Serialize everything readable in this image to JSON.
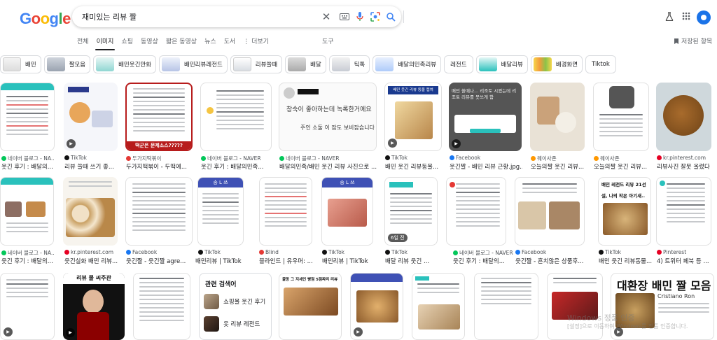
{
  "header": {
    "logo": "Google",
    "query": "재미있는 리뷰 짤"
  },
  "nav": {
    "tabs": [
      "전체",
      "이미지",
      "쇼핑",
      "동영상",
      "짧은 동영상",
      "뉴스",
      "도서",
      "⋮ 더보기"
    ],
    "active": "이미지",
    "tools": "도구",
    "saved": "저장된 항목"
  },
  "chips": [
    "배민",
    "짤모음",
    "배민웃긴만화",
    "배민리뷰레전드",
    "리뷰쓸때",
    "배달",
    "틱톡",
    "배달의민족리뷰",
    "레전드",
    "배달리뷰",
    "배경화면",
    "Tiktok"
  ],
  "results": {
    "row1": [
      {
        "source": "네이버 블로그 - NA...",
        "title": "웃긴 후기 : 배달의...",
        "video": false
      },
      {
        "source": "TikTok",
        "title": "리뷰 쓸때 쓰기 좋...",
        "video": true
      },
      {
        "source": "두가지떡볶이",
        "title": "두가지떡볶이 - 두떡에...",
        "video": false
      },
      {
        "source": "네이버 블로그 - NAVER",
        "title": "웃긴 후기 : 배달의민족...",
        "video": false
      },
      {
        "source": "네이버 블로그 - NAVER",
        "title": "배달의민족/배민 웃긴 리뷰 사진으로 ...",
        "video": false
      },
      {
        "source": "TikTok",
        "title": "배민 웃긴 리뷰동물...",
        "video": true
      },
      {
        "source": "Facebook",
        "title": "웃긴짤 - 배민 리뷰 근황.jpg...",
        "video": true
      },
      {
        "source": "퀘이사존",
        "title": "오늘의짤 웃긴 리뷰...",
        "video": false
      },
      {
        "source": "퀘이사존",
        "title": "오늘의짤 웃긴 리뷰...",
        "video": false
      },
      {
        "source": "kr.pinterest.com",
        "title": "리뷰사진 잘못 올렸다",
        "video": false
      }
    ],
    "row2": [
      {
        "source": "네이버 블로그 - NA...",
        "title": "웃긴 후기 : 배달의...",
        "video": false
      },
      {
        "source": "kr.pinterest.com",
        "title": "웃긴실화 배민 리뷰...",
        "video": false
      },
      {
        "source": "Facebook",
        "title": "웃긴짤 - 웃긴짤 agre...",
        "video": false
      },
      {
        "source": "TikTok",
        "title": "배민리뷰 | TikTok",
        "video": false
      },
      {
        "source": "Blind",
        "title": "블라인드 | 유우머: ...",
        "video": false
      },
      {
        "source": "TikTok",
        "title": "배민리뷰 | TikTok",
        "video": false
      },
      {
        "source": "TikTok",
        "title": "배달 리뷰 웃긴 ...",
        "video": false,
        "duration": "6일 전"
      },
      {
        "source": "네이버 블로그 - NAVER",
        "title": "웃긴 후기 : 배달의...",
        "video": false
      },
      {
        "source": "Facebook",
        "title": "웃긴짤 - 흔치않은 상품후...",
        "video": false
      },
      {
        "source": "TikTok",
        "title": "배민 웃긴 리뷰동물...",
        "video": false
      },
      {
        "source": "Pinterest",
        "title": "4) 트위터 페북 등 ...",
        "video": false
      }
    ]
  },
  "related": {
    "title": "관련 검색어",
    "items": [
      "쇼핑몰 웃긴 후기",
      "옷 리뷰 레전드"
    ]
  },
  "card_text": {
    "r1c3_banner": "떡군은 문제소스?????",
    "r1c5_hand1": "창숙이 좋아하는데 녹록한거에요",
    "r1c5_hand2": "주인 소둘 이 잠도 보비잡습니다",
    "r1c6_banner": "배민 웃긴 리뷰 동물 캡쳐",
    "r1c7_text": "배민 쓸때나... 리조토 시켰는데 리조토 리뷰를 못쓰게 함",
    "r2c4_header": "송 L 쓰",
    "r2c6_header": "송 L 쓰",
    "r2c10_text": "배민 레전드 리뷰 21선",
    "r2c10_sub": "설, 나의 작은 아기새..",
    "r3c2_text": "리뷰 몰 씨주관",
    "r3c5_text": "꿀망 그 지세인 빵점 5점짜리 리뷰",
    "r3c11_text": "대환장 배민 짤 모음",
    "r3c11_name": "Cristiano Ron"
  },
  "colors": {
    "google_blue": "#4285F4",
    "google_red": "#EA4335",
    "google_yellow": "#FBBC05",
    "google_green": "#34A853",
    "chip_border": "#dadce0",
    "mint": "#2ac1bc"
  },
  "watermark": {
    "line1": "Windows 정품 인증",
    "line2": "[설정]으로 이동하여 Windows를 정품 인증합니다."
  }
}
